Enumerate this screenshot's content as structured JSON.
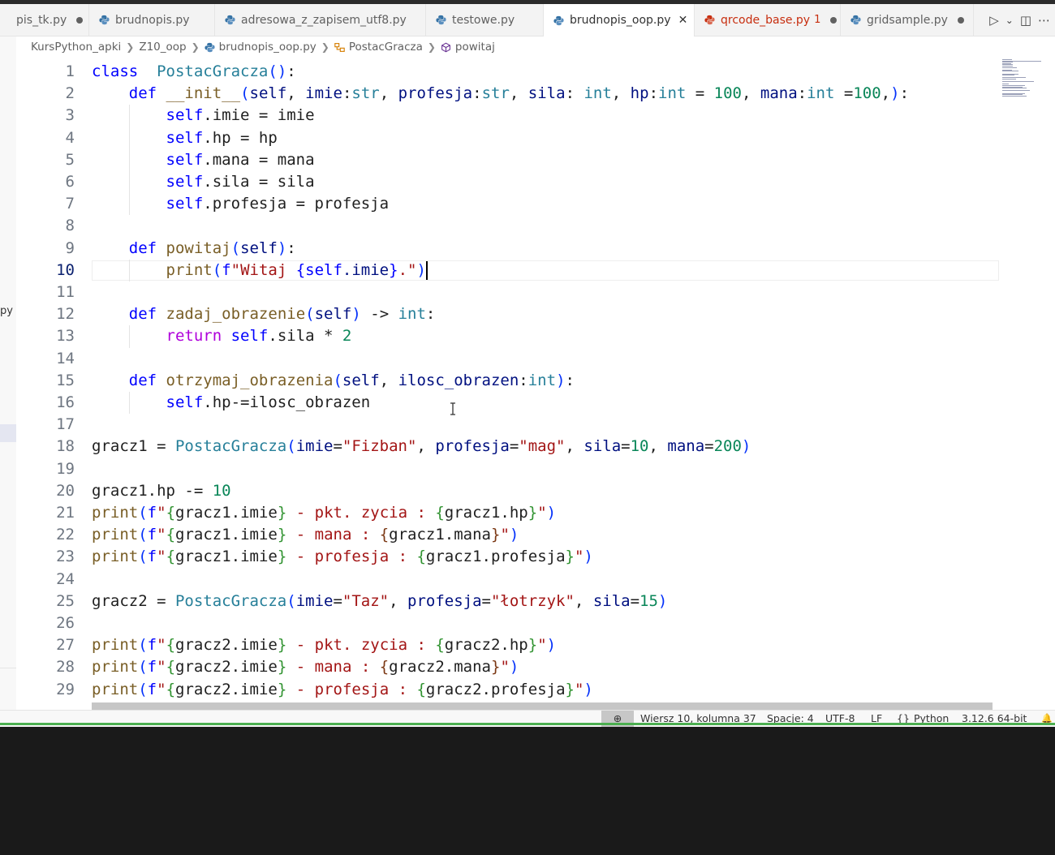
{
  "tabs": [
    {
      "label": "pis_tk.py",
      "modified": true
    },
    {
      "label": "brudnopis.py"
    },
    {
      "label": "adresowa_z_zapisem_utf8.py"
    },
    {
      "label": "testowe.py"
    },
    {
      "label": "brudnopis_oop.py",
      "active": true,
      "close": "✕"
    },
    {
      "label": "qrcode_base.py",
      "problems": "1",
      "modified": true
    },
    {
      "label": "gridsample.py",
      "modified": true
    }
  ],
  "actions": {
    "run": "▷",
    "run_menu": "⌄",
    "split": "◫",
    "more": "⋯"
  },
  "breadcrumb": [
    "KursPython_apki",
    "Z10_oop",
    "brudnopis_oop.py",
    "PostacGracza",
    "powitaj"
  ],
  "sidebar_fragment": "py",
  "editor": {
    "current_line": 10,
    "line_numbers": [
      "1",
      "2",
      "3",
      "4",
      "5",
      "6",
      "7",
      "8",
      "9",
      "10",
      "11",
      "12",
      "13",
      "14",
      "15",
      "16",
      "17",
      "18",
      "19",
      "20",
      "21",
      "22",
      "23",
      "24",
      "25",
      "26",
      "27",
      "28",
      "29"
    ],
    "lines": [
      [
        [
          "kw",
          "class"
        ],
        [
          "",
          "  "
        ],
        [
          "cls",
          "PostacGracza"
        ],
        [
          "brk",
          "()"
        ],
        [
          "",
          ":"
        ]
      ],
      [
        [
          "",
          "    "
        ],
        [
          "kw",
          "def"
        ],
        [
          "",
          " "
        ],
        [
          "fn",
          "__init__"
        ],
        [
          "brk",
          "("
        ],
        [
          "prm",
          "self"
        ],
        [
          "",
          ", "
        ],
        [
          "prm",
          "imie"
        ],
        [
          "",
          ":"
        ],
        [
          "typ",
          "str"
        ],
        [
          "",
          ", "
        ],
        [
          "prm",
          "profesja"
        ],
        [
          "",
          ":"
        ],
        [
          "typ",
          "str"
        ],
        [
          "",
          ", "
        ],
        [
          "prm",
          "sila"
        ],
        [
          "",
          ": "
        ],
        [
          "typ",
          "int"
        ],
        [
          "",
          ", "
        ],
        [
          "prm",
          "hp"
        ],
        [
          "",
          ":"
        ],
        [
          "typ",
          "int"
        ],
        [
          "",
          " = "
        ],
        [
          "num",
          "100"
        ],
        [
          "",
          ", "
        ],
        [
          "prm",
          "mana"
        ],
        [
          "",
          ":"
        ],
        [
          "typ",
          "int"
        ],
        [
          "",
          " ="
        ],
        [
          "num",
          "100"
        ],
        [
          "",
          ","
        ],
        [
          "brk",
          ")"
        ],
        [
          "",
          ":"
        ]
      ],
      [
        [
          "",
          "        "
        ],
        [
          "slf",
          "self"
        ],
        [
          "",
          ".imie = imie"
        ]
      ],
      [
        [
          "",
          "        "
        ],
        [
          "slf",
          "self"
        ],
        [
          "",
          ".hp = hp"
        ]
      ],
      [
        [
          "",
          "        "
        ],
        [
          "slf",
          "self"
        ],
        [
          "",
          ".mana = mana"
        ]
      ],
      [
        [
          "",
          "        "
        ],
        [
          "slf",
          "self"
        ],
        [
          "",
          ".sila = sila"
        ]
      ],
      [
        [
          "",
          "        "
        ],
        [
          "slf",
          "self"
        ],
        [
          "",
          ".profesja = profesja"
        ]
      ],
      [],
      [
        [
          "",
          "    "
        ],
        [
          "kw",
          "def"
        ],
        [
          "",
          " "
        ],
        [
          "fn",
          "powitaj"
        ],
        [
          "brk",
          "("
        ],
        [
          "prm",
          "self"
        ],
        [
          "brk",
          ")"
        ],
        [
          "",
          ":"
        ]
      ],
      [
        [
          "",
          "        "
        ],
        [
          "fn",
          "print"
        ],
        [
          "brk",
          "("
        ],
        [
          "kw",
          "f"
        ],
        [
          "str",
          "\"Witaj "
        ],
        [
          "kw",
          "{"
        ],
        [
          "slf",
          "self"
        ],
        [
          "prm",
          ".imie"
        ],
        [
          "kw",
          "}"
        ],
        [
          "str",
          ".\""
        ],
        [
          "brk",
          ")"
        ]
      ],
      [],
      [
        [
          "",
          "    "
        ],
        [
          "kw",
          "def"
        ],
        [
          "",
          " "
        ],
        [
          "fn",
          "zadaj_obrazenie"
        ],
        [
          "brk",
          "("
        ],
        [
          "prm",
          "self"
        ],
        [
          "brk",
          ")"
        ],
        [
          "",
          " -> "
        ],
        [
          "typ",
          "int"
        ],
        [
          "",
          ":"
        ]
      ],
      [
        [
          "",
          "        "
        ],
        [
          "ctl",
          "return"
        ],
        [
          "",
          " "
        ],
        [
          "slf",
          "self"
        ],
        [
          "",
          ".sila * "
        ],
        [
          "num",
          "2"
        ]
      ],
      [],
      [
        [
          "",
          "    "
        ],
        [
          "kw",
          "def"
        ],
        [
          "",
          " "
        ],
        [
          "fn",
          "otrzymaj_obrazenia"
        ],
        [
          "brk",
          "("
        ],
        [
          "prm",
          "self"
        ],
        [
          "",
          ", "
        ],
        [
          "prm",
          "ilosc_obrazen"
        ],
        [
          "",
          ":"
        ],
        [
          "typ",
          "int"
        ],
        [
          "brk",
          ")"
        ],
        [
          "",
          ":"
        ]
      ],
      [
        [
          "",
          "        "
        ],
        [
          "slf",
          "self"
        ],
        [
          "",
          ".hp-=ilosc_obrazen"
        ]
      ],
      [],
      [
        [
          "",
          "gracz1 = "
        ],
        [
          "cls",
          "PostacGracza"
        ],
        [
          "brk",
          "("
        ],
        [
          "prm",
          "imie"
        ],
        [
          "",
          "="
        ],
        [
          "str",
          "\"Fizban\""
        ],
        [
          "",
          ", "
        ],
        [
          "prm",
          "profesja"
        ],
        [
          "",
          "="
        ],
        [
          "str",
          "\"mag\""
        ],
        [
          "",
          ", "
        ],
        [
          "prm",
          "sila"
        ],
        [
          "",
          "="
        ],
        [
          "num",
          "10"
        ],
        [
          "",
          ", "
        ],
        [
          "prm",
          "mana"
        ],
        [
          "",
          "="
        ],
        [
          "num",
          "200"
        ],
        [
          "brk",
          ")"
        ]
      ],
      [],
      [
        [
          "",
          "gracz1.hp -= "
        ],
        [
          "num",
          "10"
        ]
      ],
      [
        [
          "fn",
          "print"
        ],
        [
          "brk",
          "("
        ],
        [
          "kw",
          "f"
        ],
        [
          "str",
          "\""
        ],
        [
          "brk2",
          "{"
        ],
        [
          "",
          "gracz1.imie"
        ],
        [
          "brk2",
          "}"
        ],
        [
          "str",
          " - pkt. zycia : "
        ],
        [
          "brk2",
          "{"
        ],
        [
          "",
          "gracz1.hp"
        ],
        [
          "brk2",
          "}"
        ],
        [
          "str",
          "\""
        ],
        [
          "brk",
          ")"
        ]
      ],
      [
        [
          "fn",
          "print"
        ],
        [
          "brk",
          "("
        ],
        [
          "kw",
          "f"
        ],
        [
          "str",
          "\""
        ],
        [
          "brk2",
          "{"
        ],
        [
          "",
          "gracz1.imie"
        ],
        [
          "brk2",
          "}"
        ],
        [
          "str",
          " - mana : "
        ],
        [
          "brk3",
          "{"
        ],
        [
          "",
          "gracz1.mana"
        ],
        [
          "brk3",
          "}"
        ],
        [
          "str",
          "\""
        ],
        [
          "brk",
          ")"
        ]
      ],
      [
        [
          "fn",
          "print"
        ],
        [
          "brk",
          "("
        ],
        [
          "kw",
          "f"
        ],
        [
          "str",
          "\""
        ],
        [
          "brk2",
          "{"
        ],
        [
          "",
          "gracz1.imie"
        ],
        [
          "brk2",
          "}"
        ],
        [
          "str",
          " - profesja : "
        ],
        [
          "brk2",
          "{"
        ],
        [
          "",
          "gracz1.profesja"
        ],
        [
          "brk2",
          "}"
        ],
        [
          "str",
          "\""
        ],
        [
          "brk",
          ")"
        ]
      ],
      [],
      [
        [
          "",
          "gracz2 = "
        ],
        [
          "cls",
          "PostacGracza"
        ],
        [
          "brk",
          "("
        ],
        [
          "prm",
          "imie"
        ],
        [
          "",
          "="
        ],
        [
          "str",
          "\"Taz\""
        ],
        [
          "",
          ", "
        ],
        [
          "prm",
          "profesja"
        ],
        [
          "",
          "="
        ],
        [
          "str",
          "\"łotrzyk\""
        ],
        [
          "",
          ", "
        ],
        [
          "prm",
          "sila"
        ],
        [
          "",
          "="
        ],
        [
          "num",
          "15"
        ],
        [
          "brk",
          ")"
        ]
      ],
      [],
      [
        [
          "fn",
          "print"
        ],
        [
          "brk",
          "("
        ],
        [
          "kw",
          "f"
        ],
        [
          "str",
          "\""
        ],
        [
          "brk2",
          "{"
        ],
        [
          "",
          "gracz2.imie"
        ],
        [
          "brk2",
          "}"
        ],
        [
          "str",
          " - pkt. zycia : "
        ],
        [
          "brk2",
          "{"
        ],
        [
          "",
          "gracz2.hp"
        ],
        [
          "brk2",
          "}"
        ],
        [
          "str",
          "\""
        ],
        [
          "brk",
          ")"
        ]
      ],
      [
        [
          "fn",
          "print"
        ],
        [
          "brk",
          "("
        ],
        [
          "kw",
          "f"
        ],
        [
          "str",
          "\""
        ],
        [
          "brk2",
          "{"
        ],
        [
          "",
          "gracz2.imie"
        ],
        [
          "brk2",
          "}"
        ],
        [
          "str",
          " - mana : "
        ],
        [
          "brk3",
          "{"
        ],
        [
          "",
          "gracz2.mana"
        ],
        [
          "brk3",
          "}"
        ],
        [
          "str",
          "\""
        ],
        [
          "brk",
          ")"
        ]
      ],
      [
        [
          "fn",
          "print"
        ],
        [
          "brk",
          "("
        ],
        [
          "kw",
          "f"
        ],
        [
          "str",
          "\""
        ],
        [
          "brk2",
          "{"
        ],
        [
          "",
          "gracz2.imie"
        ],
        [
          "brk2",
          "}"
        ],
        [
          "str",
          " - profesja : "
        ],
        [
          "brk2",
          "{"
        ],
        [
          "",
          "gracz2.profesja"
        ],
        [
          "brk2",
          "}"
        ],
        [
          "str",
          "\""
        ],
        [
          "brk",
          ")"
        ]
      ]
    ]
  },
  "status": {
    "zoom_icon": "⊕",
    "position": "Wiersz 10, kolumna 37",
    "spaces": "Spacje: 4",
    "encoding": "UTF-8",
    "eol": "LF",
    "language_icon": "{}",
    "language": "Python",
    "interpreter": "3.12.6 64-bit",
    "bell": "🔔"
  },
  "colors": {
    "accent": "#4caf50",
    "keyword": "#0000ff",
    "string": "#a31515",
    "number": "#098658",
    "function": "#795e26"
  }
}
